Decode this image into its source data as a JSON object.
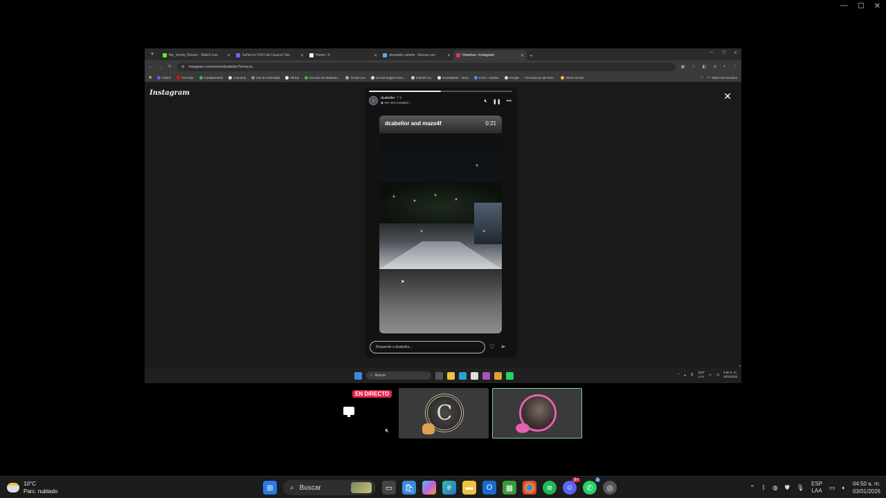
{
  "browser": {
    "tabs": [
      {
        "title": "the_monky Stream - Watch Live",
        "color": "#53fc18",
        "active": false
      },
      {
        "title": "Señal en VIVO de Caracol Tele",
        "color": "#6a6aff",
        "active": false
      },
      {
        "title": "Home / X",
        "color": "#ffffff",
        "active": false
      },
      {
        "title": "diosdado cabello - Buscar con",
        "color": "#4ab0ff",
        "active": false
      },
      {
        "title": "Historias • Instagram",
        "color": "#e1306c",
        "active": true
      }
    ],
    "url": "instagram.com/stories/dcabellor/?ni=es-la",
    "bookmarks": [
      "Twitch",
      "YouTube",
      "Fundamentos",
      "Cuevana",
      "test de velocidad",
      "TikTok",
      "Escuela de Marketin...",
      "Gmail.com",
      "Unreal Engine Foru...",
      "fortFall LCL",
      "HomeByMe - Inicio",
      "Inicio - Roblox",
      "Google",
      "Formulacion de Red...",
      "Iniciar sesión"
    ],
    "bookmarks_folder": "Todos los favoritos"
  },
  "instagram": {
    "logo": "Instagram",
    "story": {
      "username": "dcabellor",
      "time": "7 h",
      "subtitle": "Ver reel completo",
      "progress": 0.5,
      "reel_title": "dcabellor and mazo4f",
      "reel_time": "0:21",
      "reply_placeholder": "Responde a dcabellor..."
    }
  },
  "inner_taskbar": {
    "search": "Buscar",
    "lang": [
      "ESP",
      "LAA"
    ],
    "time": "4:50 a. m.",
    "date": "3/01/2026"
  },
  "tiles": {
    "live_label": "EN DIRECTO",
    "logo_letter": "C"
  },
  "taskbar": {
    "temp": "10°C",
    "weather": "Parc. nublado",
    "search": "Buscar",
    "lang": [
      "ESP",
      "LAA"
    ],
    "time": "04:50 a. m.",
    "date": "03/01/2026",
    "discord_badge": "9+",
    "whatsapp_badge": "5"
  }
}
